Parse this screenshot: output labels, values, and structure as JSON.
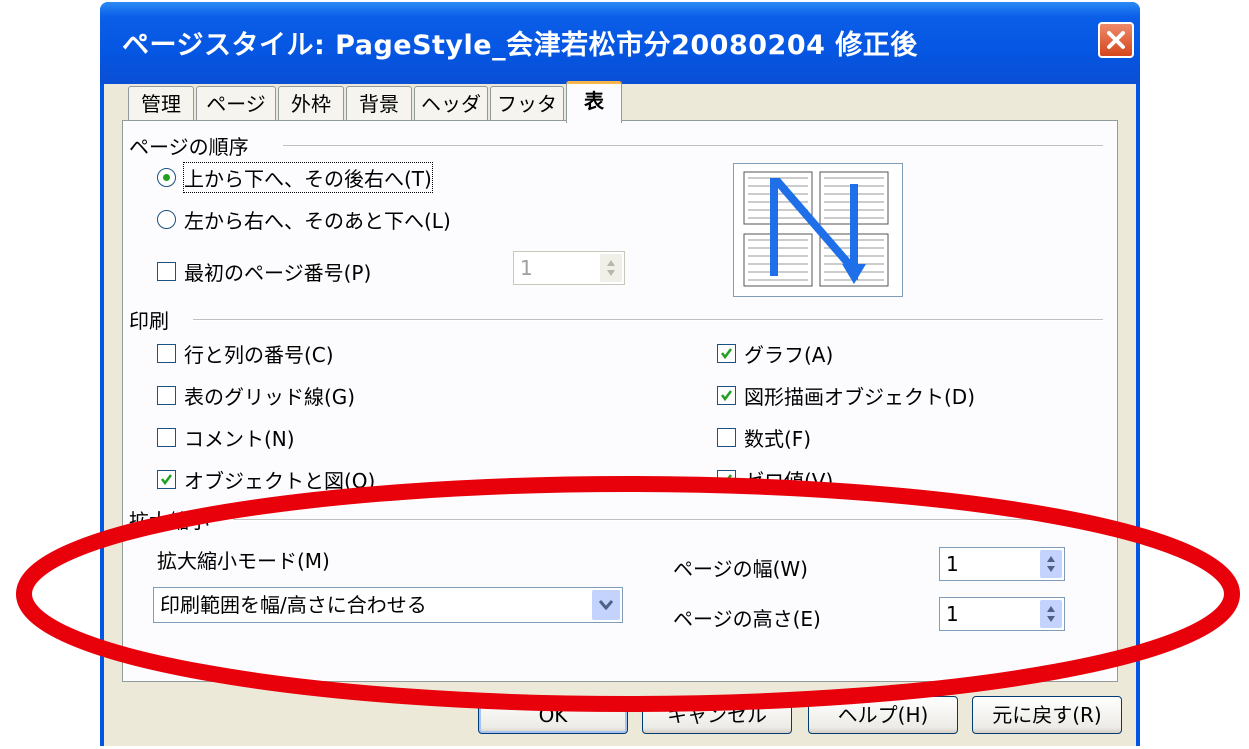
{
  "dialog": {
    "title": "ページスタイル: PageStyle_会津若松市分20080204 修正後",
    "tabs": [
      {
        "label": "管理"
      },
      {
        "label": "ページ"
      },
      {
        "label": "外枠"
      },
      {
        "label": "背景"
      },
      {
        "label": "ヘッダ"
      },
      {
        "label": "フッタ"
      },
      {
        "label": "表"
      }
    ],
    "active_tab": "表"
  },
  "page_order": {
    "section_label": "ページの順序",
    "top_to_bottom": "上から下へ、その後右へ(T)",
    "left_to_right": "左から右へ、そのあと下へ(L)",
    "selected": "top_to_bottom",
    "first_page_number_label": "最初のページ番号(P)",
    "first_page_number_checked": false,
    "first_page_number_value": "1"
  },
  "print": {
    "section_label": "印刷",
    "row_col_headers": {
      "label": "行と列の番号(C)",
      "checked": false
    },
    "grid": {
      "label": "表のグリッド線(G)",
      "checked": false
    },
    "comments": {
      "label": "コメント(N)",
      "checked": false
    },
    "objects": {
      "label": "オブジェクトと図(O)",
      "checked": true
    },
    "charts": {
      "label": "グラフ(A)",
      "checked": true
    },
    "drawing_objects": {
      "label": "図形描画オブジェクト(D)",
      "checked": true
    },
    "formulas": {
      "label": "数式(F)",
      "checked": false
    },
    "zero_values": {
      "label": "ゼロ値(V)",
      "checked": true
    }
  },
  "scale": {
    "section_label": "拡大縮小",
    "mode_label": "拡大縮小モード(M)",
    "mode_value": "印刷範囲を幅/高さに合わせる",
    "width_label": "ページの幅(W)",
    "width_value": "1",
    "height_label": "ページの高さ(E)",
    "height_value": "1"
  },
  "buttons": {
    "ok": "OK",
    "cancel": "キャンセル",
    "help": "ヘルプ(H)",
    "reset": "元に戻す(R)"
  },
  "colors": {
    "titlebar": "#0556e2",
    "annotation_ellipse": "#e8000b",
    "arrow": "#1f6fe8"
  }
}
